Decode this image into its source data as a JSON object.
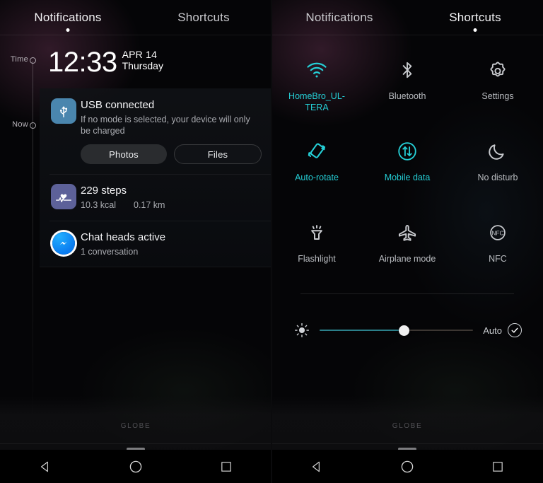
{
  "left_panel": {
    "tabs": [
      {
        "label": "Notifications",
        "active": true
      },
      {
        "label": "Shortcuts",
        "active": false
      }
    ],
    "rail": {
      "time_label": "Time",
      "now_label": "Now"
    },
    "clock": {
      "time": "12:33",
      "date": "APR 14",
      "weekday": "Thursday"
    },
    "notifications": [
      {
        "icon": "usb-icon",
        "title": "USB connected",
        "body": "If no mode is selected, your device will only be charged",
        "buttons": [
          {
            "label": "Photos",
            "style": "filled"
          },
          {
            "label": "Files",
            "style": "outlined"
          }
        ]
      },
      {
        "icon": "health-heartbeat-icon",
        "title": "229 steps",
        "body_a": "10.3 kcal",
        "body_b": "0.17 km"
      },
      {
        "icon": "messenger-icon",
        "title": "Chat heads active",
        "body": "1 conversation"
      }
    ],
    "watermark": "GLOBE"
  },
  "right_panel": {
    "tabs": [
      {
        "label": "Notifications",
        "active": false
      },
      {
        "label": "Shortcuts",
        "active": true
      }
    ],
    "shortcuts": [
      {
        "icon": "wifi-icon",
        "label": "HomeBro_UL-TERA",
        "active": true
      },
      {
        "icon": "bluetooth-icon",
        "label": "Bluetooth",
        "active": false
      },
      {
        "icon": "gear-icon",
        "label": "Settings",
        "active": false
      },
      {
        "icon": "auto-rotate-icon",
        "label": "Auto-rotate",
        "active": true
      },
      {
        "icon": "mobile-data-icon",
        "label": "Mobile data",
        "active": true
      },
      {
        "icon": "moon-icon",
        "label": "No disturb",
        "active": false
      },
      {
        "icon": "flashlight-icon",
        "label": "Flashlight",
        "active": false
      },
      {
        "icon": "airplane-icon",
        "label": "Airplane mode",
        "active": false
      },
      {
        "icon": "nfc-icon",
        "label": "NFC",
        "active": false
      }
    ],
    "brightness": {
      "icon": "brightness-icon",
      "value_percent": 55,
      "auto_label": "Auto",
      "auto_checked": true
    },
    "watermark": "GLOBE"
  },
  "navbar": {
    "back": "back-triangle-icon",
    "home": "home-circle-icon",
    "recents": "recents-square-icon"
  },
  "colors": {
    "accent_cyan": "#25cfd6",
    "slider_fill": "#2b7f8a",
    "inactive_text": "#b9bcc0",
    "panel_bg": "#050507"
  }
}
